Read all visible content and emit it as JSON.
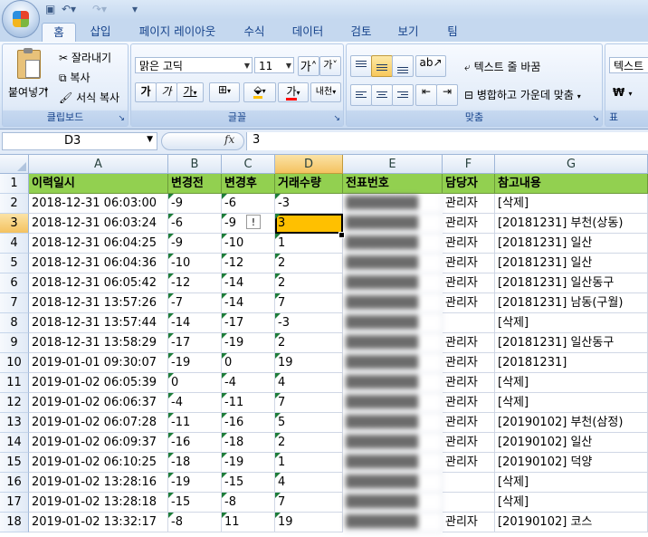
{
  "ribbon": {
    "tabs": [
      "홈",
      "삽입",
      "페이지 레이아웃",
      "수식",
      "데이터",
      "검토",
      "보기",
      "팀"
    ],
    "clipboard": {
      "paste_label": "붙여넣기",
      "cut_label": "잘라내기",
      "copy_label": "복사",
      "format_painter_label": "서식 복사",
      "group_label": "클립보드"
    },
    "font": {
      "font_name": "맑은 고딕",
      "font_size": "11",
      "grow_label": "가",
      "shrink_label": "가",
      "bold_label": "가",
      "italic_label": "가",
      "underline_label": "가",
      "font_color_label": "가",
      "phonetic_label": "내천",
      "group_label": "글꼴"
    },
    "alignment": {
      "wrap_text_label": "텍스트 줄 바꿈",
      "merge_center_label": "병합하고 가운데 맞춤",
      "group_label": "맞춤"
    },
    "number": {
      "format_label": "텍스트",
      "currency_symbol": "₩",
      "group_label": "표"
    }
  },
  "formula_bar": {
    "name_box": "D3",
    "fx_label": "fx",
    "content": "3"
  },
  "columns": [
    "A",
    "B",
    "C",
    "D",
    "E",
    "F",
    "G"
  ],
  "selected_column": "D",
  "selected_row": 3,
  "header_row": [
    "이력일시",
    "변경전",
    "변경후",
    "거래수량",
    "전표번호",
    "담당자",
    "참고내용"
  ],
  "rows": [
    {
      "n": "2",
      "a": "2018-12-31 06:03:00",
      "b": "-9",
      "c": "-6",
      "d": "-3",
      "e": "████████",
      "f": "관리자",
      "g": "[삭제]"
    },
    {
      "n": "3",
      "a": "2018-12-31 06:03:24",
      "b": "-6",
      "c": "-9",
      "d": "3",
      "e": "████████",
      "f": "관리자",
      "g": "[20181231] 부천(상동)"
    },
    {
      "n": "4",
      "a": "2018-12-31 06:04:25",
      "b": "-9",
      "c": "-10",
      "d": "1",
      "e": "████████",
      "f": "관리자",
      "g": "[20181231] 일산"
    },
    {
      "n": "5",
      "a": "2018-12-31 06:04:36",
      "b": "-10",
      "c": "-12",
      "d": "2",
      "e": "████████",
      "f": "관리자",
      "g": "[20181231] 일산"
    },
    {
      "n": "6",
      "a": "2018-12-31 06:05:42",
      "b": "-12",
      "c": "-14",
      "d": "2",
      "e": "████████",
      "f": "관리자",
      "g": "[20181231] 일산동구"
    },
    {
      "n": "7",
      "a": "2018-12-31 13:57:26",
      "b": "-7",
      "c": "-14",
      "d": "7",
      "e": "████████",
      "f": "관리자",
      "g": "[20181231] 남동(구월)"
    },
    {
      "n": "8",
      "a": "2018-12-31 13:57:44",
      "b": "-14",
      "c": "-17",
      "d": "-3",
      "e": "████████",
      "f": "",
      "g": "[삭제]"
    },
    {
      "n": "9",
      "a": "2018-12-31 13:58:29",
      "b": "-17",
      "c": "-19",
      "d": "2",
      "e": "████████",
      "f": "관리자",
      "g": "[20181231] 일산동구"
    },
    {
      "n": "10",
      "a": "2019-01-01 09:30:07",
      "b": "-19",
      "c": "0",
      "d": "19",
      "e": "████████",
      "f": "관리자",
      "g": "[20181231]"
    },
    {
      "n": "11",
      "a": "2019-01-02 06:05:39",
      "b": "0",
      "c": "-4",
      "d": "4",
      "e": "████████",
      "f": "관리자",
      "g": "[삭제]"
    },
    {
      "n": "12",
      "a": "2019-01-02 06:06:37",
      "b": "-4",
      "c": "-11",
      "d": "7",
      "e": "████████",
      "f": "관리자",
      "g": "[삭제]"
    },
    {
      "n": "13",
      "a": "2019-01-02 06:07:28",
      "b": "-11",
      "c": "-16",
      "d": "5",
      "e": "████████",
      "f": "관리자",
      "g": "[20190102] 부천(삼정)"
    },
    {
      "n": "14",
      "a": "2019-01-02 06:09:37",
      "b": "-16",
      "c": "-18",
      "d": "2",
      "e": "████████",
      "f": "관리자",
      "g": "[20190102] 일산"
    },
    {
      "n": "15",
      "a": "2019-01-02 06:10:25",
      "b": "-18",
      "c": "-19",
      "d": "1",
      "e": "████████",
      "f": "관리자",
      "g": "[20190102] 덕양"
    },
    {
      "n": "16",
      "a": "2019-01-02 13:28:16",
      "b": "-19",
      "c": "-15",
      "d": "4",
      "e": "████████",
      "f": "",
      "g": "[삭제]"
    },
    {
      "n": "17",
      "a": "2019-01-02 13:28:18",
      "b": "-15",
      "c": "-8",
      "d": "7",
      "e": "████████",
      "f": "",
      "g": "[삭제]"
    },
    {
      "n": "18",
      "a": "2019-01-02 13:32:17",
      "b": "-8",
      "c": "11",
      "d": "19",
      "e": "████████",
      "f": "관리자",
      "g": "[20190102] 코스"
    }
  ],
  "colors": {
    "header_fill": "#92d050",
    "active_cell_fill": "#ffc000",
    "ribbon_text": "#15428b"
  }
}
